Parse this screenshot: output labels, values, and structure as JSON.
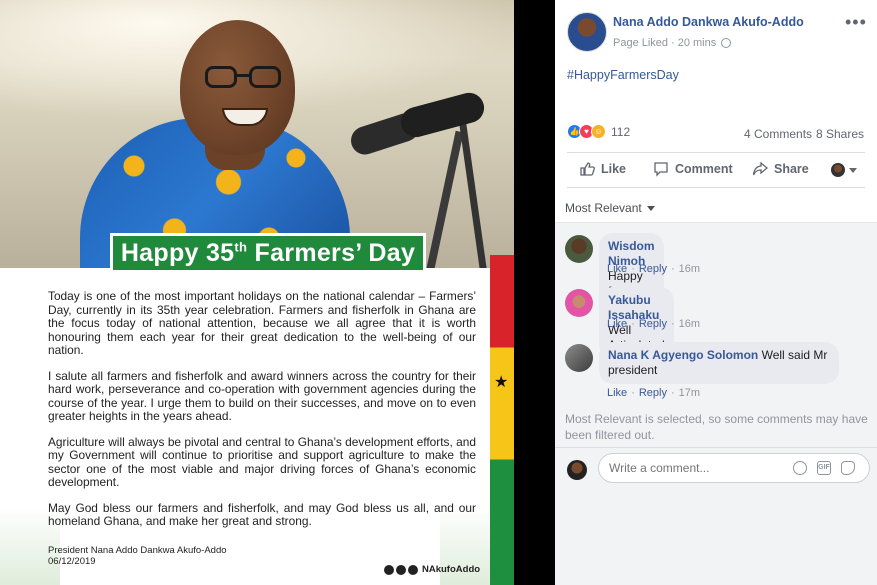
{
  "image": {
    "banner_prefix": "Happy 35",
    "banner_sup": "th",
    "banner_suffix": " Farmers’ Day",
    "paragraphs": [
      "Today is one of the most important holidays on the national calendar – Farmers’ Day, currently in its 35th year celebration. Farmers and fisherfolk in Ghana are the focus today of national attention, because we all agree that it is worth honouring them each year for their great dedication to the well-being of our nation.",
      "I salute all farmers and fisherfolk and award winners across the country for their hard work, perseverance and co-operation with government agencies during the course of the year. I urge them to build on their successes, and move on to even greater heights in the years ahead.",
      "Agriculture will always be pivotal and central to Ghana’s development efforts, and my Government will continue to prioritise and support agriculture to make the sector one of the most viable and major driving forces of Ghana’s economic development.",
      "May God bless our farmers and fisherfolk, and may God bless us all, and our homeland Ghana, and make her great and strong."
    ],
    "signature_name": "President Nana Addo Dankwa Akufo-Addo",
    "signature_date": "06/12/2019",
    "social_handle": "NAkufoAddo"
  },
  "post": {
    "author": "Nana Addo Dankwa Akufo-Addo",
    "meta_liked": "Page Liked",
    "meta_sep": "·",
    "meta_time": "20 mins",
    "more_label": "•••",
    "text": "#HappyFarmersDay",
    "reaction_count": "112",
    "comments_count": "4 Comments",
    "shares_count": "8 Shares",
    "actions": {
      "like": "Like",
      "comment": "Comment",
      "share": "Share"
    },
    "sort_label": "Most Relevant"
  },
  "comments": [
    {
      "author": "Wisdom Nimoh",
      "text": "Happy farmers day",
      "like": "Like",
      "dot": "·",
      "reply": "Reply",
      "time": "16m"
    },
    {
      "author": "Yakubu Issahaku",
      "text": "Well Articulated",
      "like": "Like",
      "dot": "·",
      "reply": "Reply",
      "time": "16m"
    },
    {
      "author": "Nana K Agyengo Solomon",
      "text": "Well said Mr president",
      "like": "Like",
      "dot": "·",
      "reply": "Reply",
      "time": "17m"
    }
  ],
  "filter_note": "Most Relevant is selected, so some comments may have been filtered out.",
  "compose": {
    "placeholder": "Write a comment...",
    "gif": "GIF"
  },
  "colors": {
    "link": "#365899",
    "banner_green": "#1f8a3b",
    "flag_red": "#d8232a",
    "flag_gold": "#f5c518",
    "flag_green": "#1e8f3e"
  }
}
